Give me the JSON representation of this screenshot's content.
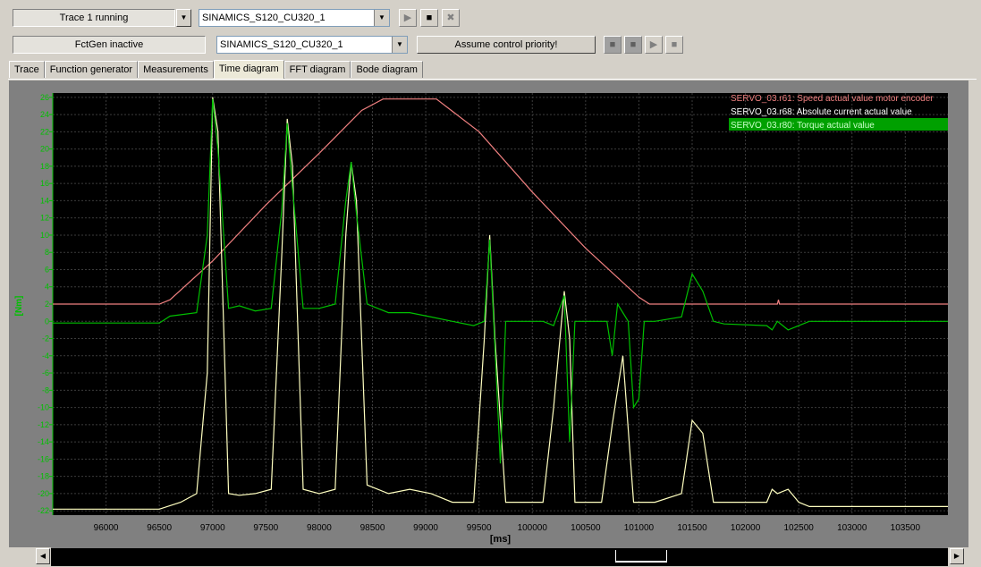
{
  "toolbar": {
    "trace_status": "Trace 1 running",
    "trace_device": "SINAMICS_S120_CU320_1",
    "fctgen_status": "FctGen  inactive",
    "fctgen_device": "SINAMICS_S120_CU320_1",
    "assume_control_label": "Assume control priority!"
  },
  "tabs": [
    {
      "label": "Trace"
    },
    {
      "label": "Function generator"
    },
    {
      "label": "Measurements"
    },
    {
      "label": "Time diagram",
      "active": true
    },
    {
      "label": "FFT diagram"
    },
    {
      "label": "Bode diagram"
    }
  ],
  "icons": {
    "play": "play-icon",
    "stop": "stop-icon",
    "clear": "clear-trace-icon",
    "fg_start": "fg-start-icon",
    "fg_stop": "fg-stop-icon"
  },
  "colors": {
    "plot_bg": "#000000",
    "grid": "#3c3c3c",
    "speed": "#f08080",
    "current": "#ffffc0",
    "torque": "#00c000"
  },
  "chart_data": {
    "type": "line",
    "xlabel": "[ms]",
    "ylabel": "[Nm]",
    "xlim": [
      95500,
      103900
    ],
    "ylim": [
      -22.5,
      26.5
    ],
    "x_ticks": [
      96000,
      96500,
      97000,
      97500,
      98000,
      98500,
      99000,
      99500,
      100000,
      100500,
      101000,
      101500,
      102000,
      102500,
      103000,
      103500
    ],
    "y_ticks": [
      26,
      24,
      22,
      20,
      18,
      16,
      14,
      12,
      10,
      8,
      6,
      4,
      2,
      0,
      -2,
      -4,
      -6,
      -8,
      -10,
      -12,
      -14,
      -16,
      -18,
      -20,
      -22
    ],
    "grid": true,
    "legend_placement": "top-right",
    "series": [
      {
        "name": "SERVO_03.r61: Speed actual value motor encoder",
        "color": "#f08080",
        "x": [
          95500,
          96500,
          96600,
          97000,
          97500,
          98000,
          98400,
          98600,
          99100,
          99500,
          100000,
          100500,
          101000,
          101100,
          102300,
          102310,
          102320,
          103900
        ],
        "y": [
          2.0,
          2.0,
          2.5,
          7.0,
          13.5,
          19.5,
          24.5,
          25.8,
          25.8,
          22.0,
          15.0,
          8.5,
          2.8,
          2.0,
          2.0,
          2.5,
          2.0,
          2.0
        ]
      },
      {
        "name": "SERVO_03.r68: Absolute current actual value",
        "color": "#ffffc0",
        "x": [
          95500,
          96500,
          96700,
          96850,
          96950,
          97000,
          97050,
          97150,
          97250,
          97400,
          97550,
          97650,
          97700,
          97750,
          97850,
          98000,
          98150,
          98250,
          98300,
          98350,
          98450,
          98650,
          98850,
          99050,
          99250,
          99450,
          99550,
          99600,
          99650,
          99750,
          99950,
          100100,
          100200,
          100300,
          100350,
          100400,
          100500,
          100650,
          100750,
          100850,
          100950,
          101000,
          101050,
          101150,
          101400,
          101500,
          101600,
          101700,
          101800,
          102200,
          102250,
          102300,
          102400,
          102500,
          102600,
          103900
        ],
        "y": [
          -21.8,
          -21.8,
          -21.0,
          -20.0,
          -6.0,
          26.0,
          22.0,
          -20.0,
          -20.2,
          -20.0,
          -19.5,
          8.0,
          23.5,
          18.0,
          -19.5,
          -20.0,
          -19.5,
          10.0,
          18.5,
          14.0,
          -19.0,
          -20.0,
          -19.5,
          -20.0,
          -21.0,
          -21.0,
          -2.0,
          10.0,
          -2.0,
          -21.0,
          -21.0,
          -21.0,
          -10.0,
          3.5,
          -2.0,
          -21.0,
          -21.0,
          -21.0,
          -12.0,
          -4.0,
          -21.0,
          -21.0,
          -21.0,
          -21.0,
          -20.0,
          -11.5,
          -13.0,
          -21.0,
          -21.0,
          -21.0,
          -19.5,
          -20.0,
          -19.5,
          -21.0,
          -21.5,
          -21.5
        ]
      },
      {
        "name": "SERVO_03.r80: Torque actual value",
        "color": "#00c000",
        "x": [
          95500,
          96500,
          96600,
          96850,
          96950,
          97000,
          97050,
          97150,
          97250,
          97400,
          97550,
          97650,
          97700,
          97750,
          97850,
          98000,
          98150,
          98250,
          98300,
          98350,
          98450,
          98650,
          98850,
          99050,
          99250,
          99450,
          99550,
          99600,
          99650,
          99700,
          99750,
          99900,
          100100,
          100200,
          100300,
          100350,
          100400,
          100500,
          100700,
          100750,
          100800,
          100900,
          100950,
          101000,
          101050,
          101150,
          101400,
          101500,
          101600,
          101700,
          101800,
          102200,
          102250,
          102300,
          102400,
          102500,
          102600,
          103900
        ],
        "y": [
          -0.2,
          -0.2,
          0.6,
          1.0,
          10.0,
          25.8,
          20.0,
          1.5,
          1.8,
          1.2,
          1.5,
          13.0,
          23.0,
          15.5,
          1.5,
          1.5,
          2.0,
          14.0,
          18.5,
          12.5,
          2.0,
          1.0,
          1.0,
          0.5,
          0.0,
          -0.5,
          0.0,
          9.5,
          -3.0,
          -16.5,
          0.0,
          0.0,
          0.0,
          -0.5,
          3.0,
          -14.0,
          0.0,
          0.0,
          0.0,
          -4.0,
          2.0,
          0.0,
          -10.0,
          -9.0,
          0.0,
          0.0,
          0.5,
          5.5,
          3.5,
          0.0,
          -0.3,
          -0.5,
          -1.0,
          0.0,
          -1.0,
          -0.5,
          0.0,
          0.0
        ]
      }
    ]
  }
}
